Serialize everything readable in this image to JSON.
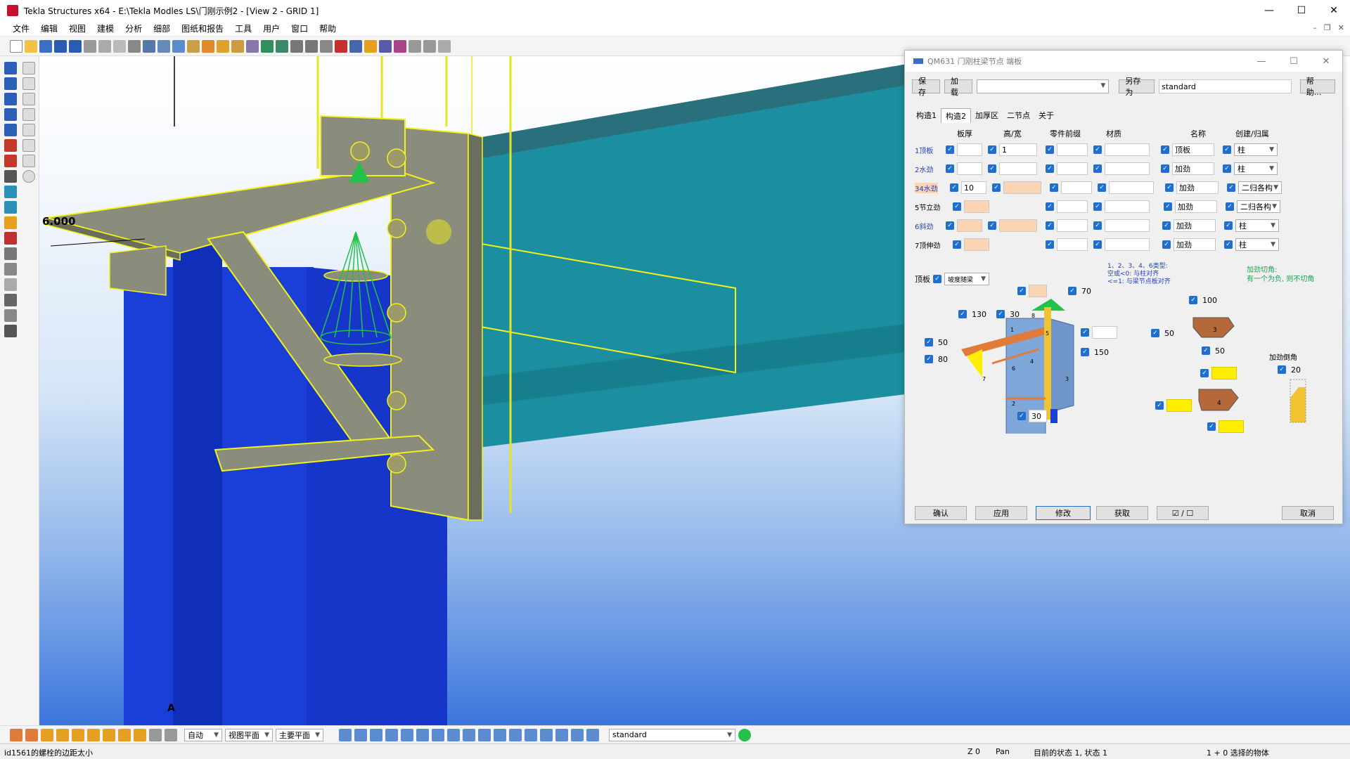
{
  "window": {
    "title": "Tekla Structures x64 - E:\\Tekla Modles LS\\门刚示例2 - [View 2 - GRID 1]",
    "controls": [
      "—",
      "☐",
      "✕"
    ]
  },
  "menu": [
    "文件",
    "编辑",
    "视图",
    "建模",
    "分析",
    "细部",
    "图纸和报告",
    "工具",
    "用户",
    "窗口",
    "帮助"
  ],
  "viewport": {
    "section_mark_top": "A",
    "section_mark_bottom": "A",
    "elevation_label": "6.000",
    "axis_label": "Z"
  },
  "dialog": {
    "title": "QM631 门刚柱梁节点 端板",
    "controls": [
      "—",
      "☐",
      "✕"
    ],
    "save": "保存",
    "load": "加载",
    "load_value": "",
    "save_as": "另存为",
    "save_as_value": "standard",
    "help": "帮助...",
    "tabs": [
      "构造1",
      "构造2",
      "加厚区",
      "二节点",
      "关于"
    ],
    "columns": [
      "板厚",
      "高/宽",
      "零件前缀",
      "材质",
      "名称",
      "创建/归属"
    ],
    "rows": [
      {
        "label": "1顶板",
        "thick": "",
        "hw": "1",
        "prefix": "",
        "material": "",
        "name": "顶板",
        "owner": "柱"
      },
      {
        "label": "2水劲",
        "thick": "",
        "hw": "",
        "prefix": "",
        "material": "",
        "name": "加劲",
        "owner": "柱"
      },
      {
        "label": "34水劲",
        "thick": "10",
        "hw": "",
        "prefix": "",
        "material": "",
        "name": "加劲",
        "owner": "二归各构"
      },
      {
        "label": "5节立劲",
        "thick": "",
        "hw": "",
        "prefix": "",
        "material": "",
        "name": "加劲",
        "owner": "二归各构"
      },
      {
        "label": "6斜劲",
        "thick": "",
        "hw": "",
        "prefix": "",
        "material": "",
        "name": "加劲",
        "owner": "柱"
      },
      {
        "label": "7顶伸劲",
        "thick": "",
        "hw": "",
        "prefix": "",
        "material": "",
        "name": "加劲",
        "owner": "柱"
      }
    ],
    "top_plate_label": "顶板",
    "top_plate_option": "坡度随梁",
    "note_blue": [
      "1、2、3、4、6类型:",
      "空或<0: 与柱对齐",
      "<=1: 与梁节点板对齐"
    ],
    "note_green": [
      "加劲切角:",
      "有一个为负, 则不切角"
    ],
    "dims": {
      "d70": "70",
      "d130": "130",
      "d30a": "30",
      "d50a": "50",
      "d80": "80",
      "d150": "150",
      "d30b": "30",
      "d100": "100",
      "d50b": "50",
      "d50c": "50",
      "chamfer_label": "加劲倒角",
      "d20": "20"
    },
    "diagram_labels": [
      "8",
      "1",
      "5",
      "6",
      "4",
      "7",
      "2",
      "3"
    ],
    "sketch_label": "3",
    "sketch_label2": "4",
    "buttons": [
      "确认",
      "应用",
      "修改",
      "获取",
      "☑ / ☐",
      "取消"
    ]
  },
  "bottombar": {
    "mode": "自动",
    "view_plane": "视图平面",
    "main_plane": "主要平面",
    "standard": "standard"
  },
  "status": {
    "message": "id1561的螺栓的边距太小",
    "z": "Z 0",
    "pan": "Pan",
    "state": "目前的状态 1, 状态 1",
    "selected": "1 + 0 选择的物体"
  }
}
